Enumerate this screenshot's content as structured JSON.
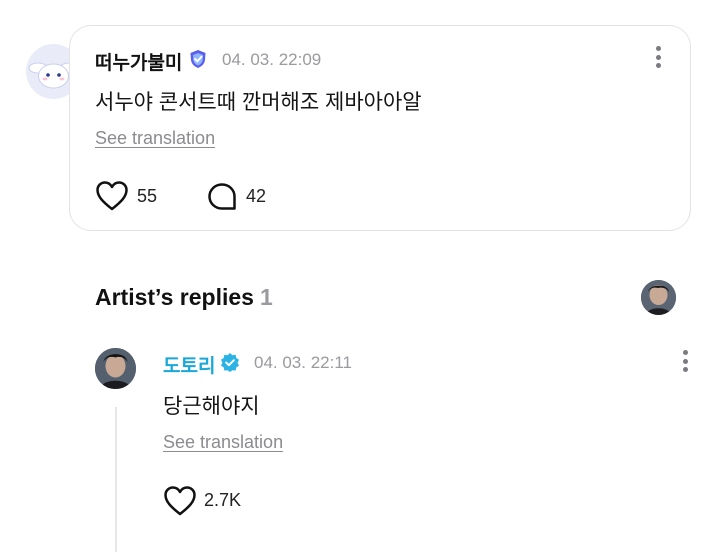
{
  "comment": {
    "author": "떠누가불미",
    "timestamp": "04. 03. 22:09",
    "text": "서누야 콘서트때 깐머해조 제바아아알",
    "translate_label": "See translation",
    "likes": "55",
    "replies": "42"
  },
  "artist_replies": {
    "title": "Artist’s replies",
    "count": "1",
    "items": [
      {
        "author": "도토리",
        "timestamp": "04. 03. 22:11",
        "text": "당근해야지",
        "translate_label": "See translation",
        "likes": "2.7K"
      }
    ]
  },
  "colors": {
    "artist_name": "#1aa7d9",
    "fan_badge": "#5b5cf0",
    "artist_badge": "#2bb3e6",
    "muted": "#9a9a9f"
  }
}
